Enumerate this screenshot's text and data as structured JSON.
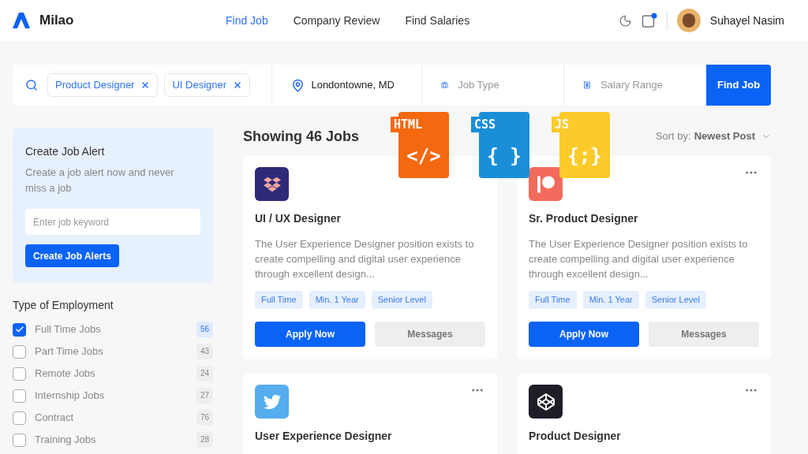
{
  "header": {
    "logo": "Milao",
    "nav": [
      {
        "label": "Find Job",
        "selected": true
      },
      {
        "label": "Company Review",
        "selected": false
      },
      {
        "label": "Find Salaries",
        "selected": false
      }
    ],
    "user": "Suhayel Nasim"
  },
  "search": {
    "tags": [
      "Product Designer",
      "UI Designer"
    ],
    "location": "Londontowne, MD",
    "job_type_placeholder": "Job Type",
    "salary_placeholder": "Salary Range",
    "button": "Find Job"
  },
  "alert": {
    "title": "Create Job Alert",
    "text": "Create a job alert now and never miss a job",
    "placeholder": "Enter job keyword",
    "button": "Create Job Alerts"
  },
  "employment": {
    "title": "Type of Employment",
    "items": [
      {
        "label": "Full Time Jobs",
        "count": "56",
        "checked": true
      },
      {
        "label": "Part Time Jobs",
        "count": "43",
        "checked": false
      },
      {
        "label": "Remote Jobs",
        "count": "24",
        "checked": false
      },
      {
        "label": "Internship Jobs",
        "count": "27",
        "checked": false
      },
      {
        "label": "Contract",
        "count": "76",
        "checked": false
      },
      {
        "label": "Training Jobs",
        "count": "28",
        "checked": false
      }
    ]
  },
  "results": {
    "title": "Showing 46 Jobs",
    "sort_label": "Sort by:",
    "sort_value": "Newest Post"
  },
  "file_badges": [
    {
      "label": "HTML",
      "symbol": "</>",
      "color": "#f4680f"
    },
    {
      "label": "CSS",
      "symbol": "{ }",
      "color": "#1a8fd8"
    },
    {
      "label": "JS",
      "symbol": "{;}",
      "color": "#fcca2a"
    }
  ],
  "jobs": [
    {
      "kind": "dropbox",
      "more_menu": false,
      "title": "UI / UX Designer",
      "description": "The User Experience Designer position exists to create compelling and digital user experience through excellent design...",
      "tags": [
        "Full Time",
        "Min. 1 Year",
        "Senior Level"
      ],
      "apply": "Apply Now",
      "messages": "Messages"
    },
    {
      "kind": "patreon",
      "more_menu": true,
      "title": "Sr. Product Designer",
      "description": "The User Experience Designer position exists to create compelling and digital user experience through excellent design...",
      "tags": [
        "Full Time",
        "Min. 1 Year",
        "Senior Level"
      ],
      "apply": "Apply Now",
      "messages": "Messages"
    },
    {
      "kind": "twitter",
      "more_menu": true,
      "title": "User Experience Designer"
    },
    {
      "kind": "codepen",
      "more_menu": true,
      "title": "Product Designer"
    }
  ]
}
